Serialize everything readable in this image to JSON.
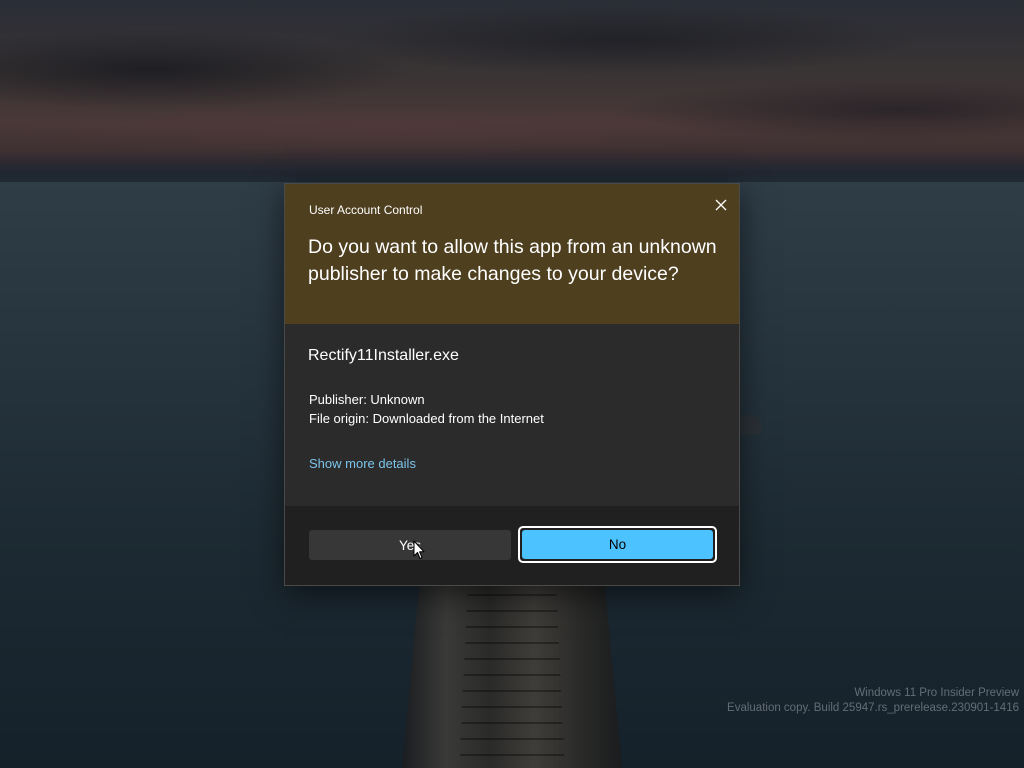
{
  "dialog": {
    "title": "User Account Control",
    "question": "Do you want to allow this app from an unknown publisher to make changes to your device?",
    "app_name": "Rectify11Installer.exe",
    "publisher": "Publisher: Unknown",
    "file_origin": "File origin: Downloaded from the Internet",
    "more_details_link": "Show more details",
    "yes_label": "Yes",
    "no_label": "No",
    "close_icon": "close-icon",
    "header_color": "#4e3f1f",
    "accent_color": "#4cc2ff",
    "link_color": "#7cc4ea"
  },
  "watermark": {
    "line1": "Windows 11 Pro Insider Preview",
    "line2": "Evaluation copy. Build 25947.rs_prerelease.230901-1416"
  }
}
